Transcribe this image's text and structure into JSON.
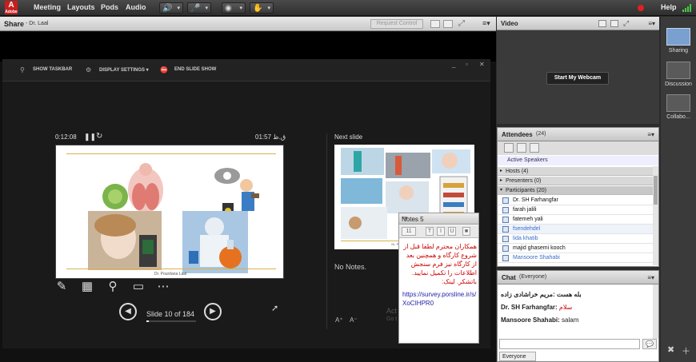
{
  "menubar": {
    "logo_text": "A",
    "logo_sub": "Adobe",
    "items": [
      "Meeting",
      "Layouts",
      "Pods",
      "Audio"
    ],
    "help": "Help"
  },
  "share": {
    "title": "Share",
    "presenter": "- Dr. Laal",
    "request_control": "Request Control"
  },
  "presentation": {
    "toolbar": [
      "SHOW TASKBAR",
      "DISPLAY SETTINGS ▾",
      "END SLIDE SHOW"
    ],
    "elapsed": "0:12:08",
    "clock": "01:57 ق.ظ",
    "next_slide_label": "Next slide",
    "notes_text": "No Notes.",
    "slide_counter": "Slide 10 of 184",
    "progress": 0.054,
    "slide_footer": "Dr. Pourdana Laal",
    "next_footer": "Dr. Pourdana Laal",
    "act_text": "Act",
    "go_text": "Go t"
  },
  "notes_pod": {
    "title": "Notes 5",
    "font_size": "11",
    "text": "همکاران محترم لطفا قبل از شروع کارگاه و همچنین بعد از کارگاه نیز فرم سنجش اطلاعات را تکمیل نمایید. باتشکر. لینک:",
    "link": "https://survey.porsline.ir/s/XoCIHPR0"
  },
  "video_pod": {
    "title": "Video",
    "button": "Start My Webcam"
  },
  "attendees_pod": {
    "title": "Attendees",
    "count": "(24)",
    "active_speakers": "Active Speakers",
    "hosts": "Hosts (4)",
    "presenters": "Presenters (0)",
    "participants": "Participants (20)",
    "rows": [
      {
        "name": "Dr. SH Farhangfar",
        "blue": false
      },
      {
        "name": "farah jalili",
        "blue": false
      },
      {
        "name": "fatemeh yali",
        "blue": false
      },
      {
        "name": "fsendehdel",
        "blue": true
      },
      {
        "name": "lida khatib",
        "blue": true
      },
      {
        "name": "majid ghasemi kooch",
        "blue": false
      },
      {
        "name": "Mansoore Shahabi",
        "blue": true
      }
    ]
  },
  "chat_pod": {
    "title": "Chat",
    "scope": "(Everyone)",
    "messages": [
      {
        "from": "",
        "text": "بله  هست :مریم  خراشادی زاده"
      },
      {
        "from": "Dr. SH Farhangfar:",
        "text": "سلام"
      },
      {
        "from": "Mansoore Shahabi:",
        "text": "salam"
      }
    ],
    "tab": "Everyone"
  },
  "layouts": [
    {
      "label": "Sharing",
      "active": true
    },
    {
      "label": "Discussion",
      "active": false
    },
    {
      "label": "Collabo...",
      "active": false
    }
  ],
  "colors": {
    "accent": "#7aa0d0",
    "notes_red": "#cc0000",
    "link_blue": "#2222aa",
    "record": "#dd2222"
  }
}
